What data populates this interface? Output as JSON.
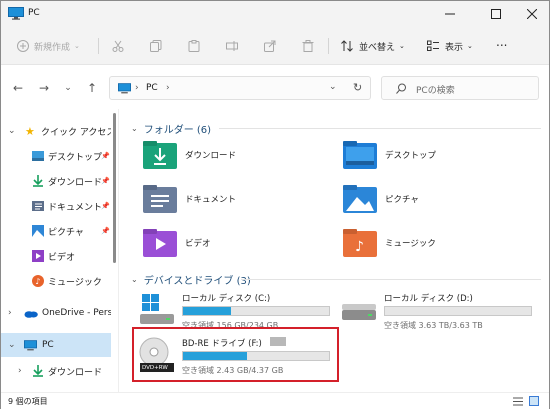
{
  "window": {
    "title": "PC",
    "minimize_icon": "minimize-icon",
    "maximize_icon": "maximize-icon",
    "close_icon": "close-icon"
  },
  "commandbar": {
    "new_label": "新規作成",
    "sort_label": "並べ替え",
    "view_label": "表示",
    "more_label": "..."
  },
  "address": {
    "crumb": "PC",
    "search_placeholder": "PCの検索"
  },
  "sidebar": {
    "quick_access": "クイック アクセス",
    "items": [
      {
        "label": "デスクトップ",
        "icon": "desktop-icon"
      },
      {
        "label": "ダウンロード",
        "icon": "download-icon"
      },
      {
        "label": "ドキュメント",
        "icon": "document-icon"
      },
      {
        "label": "ピクチャ",
        "icon": "pictures-icon"
      },
      {
        "label": "ビデオ",
        "icon": "video-icon"
      },
      {
        "label": "ミュージック",
        "icon": "music-icon"
      }
    ],
    "onedrive": "OneDrive - Perso",
    "pc": "PC",
    "pc_child": "ダウンロード"
  },
  "folders": {
    "header": "フォルダー (6)",
    "items": [
      {
        "label": "ダウンロード"
      },
      {
        "label": "デスクトップ"
      },
      {
        "label": "ドキュメント"
      },
      {
        "label": "ピクチャ"
      },
      {
        "label": "ビデオ"
      },
      {
        "label": "ミュージック"
      }
    ]
  },
  "drives": {
    "header": "デバイスとドライブ (3)",
    "items": [
      {
        "name": "ローカル ディスク (C:)",
        "free": "空き領域 156 GB/234 GB",
        "used_fraction": 0.33
      },
      {
        "name": "ローカル ディスク (D:)",
        "free": "空き領域 3.63 TB/3.63 TB",
        "used_fraction": 0.0
      },
      {
        "name": "BD-RE ドライブ (F:)",
        "free": "空き領域 2.43 GB/4.37 GB",
        "used_fraction": 0.44,
        "disc_label": "DVD+RW"
      }
    ]
  },
  "status": {
    "count": "9 個の項目"
  },
  "colors": {
    "accent": "#26a0da",
    "highlight": "#d4202a",
    "selected": "#cce4f7"
  }
}
